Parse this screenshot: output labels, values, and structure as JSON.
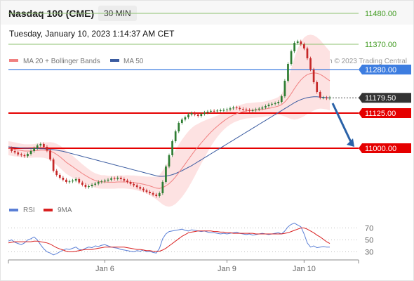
{
  "header": {
    "title": "Nasdaq 100 (CME)",
    "timeframe": "30 MIN",
    "timestamp": "Tuesday, January 10, 2023 1:14:37 AM CET"
  },
  "credit": "Research © 2023 Trading Central",
  "colors": {
    "up_candle": "#2e7d32",
    "down_candle": "#c62828",
    "bollinger_fill": "#fde2e2",
    "ma20": "#f08080",
    "ma50": "#3a5ba0",
    "resistance_green": "#8dc26f",
    "level_blue": "#3d7de0",
    "level_red": "#e50000",
    "rsi": "#5a7fd6",
    "rsi_ma": "#d92020",
    "arrow": "#2a62a8"
  },
  "chart_data": [
    {
      "type": "line",
      "name": "price",
      "title": "Nasdaq 100 (CME)",
      "legend": [
        {
          "label": "MA 20 + Bollinger Bands",
          "color": "#f08080"
        },
        {
          "label": "MA 50",
          "color": "#3a5ba0"
        }
      ],
      "x_ticks": [
        "Jan 6",
        "Jan 9",
        "Jan 10"
      ],
      "ylim": [
        10890,
        11540
      ],
      "levels": [
        {
          "value": 11480.0,
          "label": "11480.00",
          "kind": "resistance",
          "color": "#8dc26f"
        },
        {
          "value": 11370.0,
          "label": "11370.00",
          "kind": "resistance",
          "color": "#8dc26f"
        },
        {
          "value": 11280.0,
          "label": "11280.00",
          "kind": "pivot",
          "color": "#3d7de0"
        },
        {
          "value": 11179.5,
          "label": "11179.50",
          "kind": "last_price",
          "color": "#333333"
        },
        {
          "value": 11125.0,
          "label": "11125.00",
          "kind": "support",
          "color": "#e50000"
        },
        {
          "value": 11000.0,
          "label": "11000.00",
          "kind": "support",
          "color": "#e50000"
        }
      ],
      "close": [
        11000,
        10990,
        10985,
        10978,
        10975,
        10972,
        10980,
        10990,
        11000,
        11010,
        11015,
        11005,
        10992,
        10960,
        10920,
        10905,
        10895,
        10888,
        10880,
        10882,
        10885,
        10890,
        10878,
        10870,
        10862,
        10865,
        10870,
        10874,
        10880,
        10882,
        10885,
        10888,
        10893,
        10891,
        10895,
        10890,
        10885,
        10880,
        10873,
        10868,
        10862,
        10856,
        10850,
        10845,
        10840,
        10835,
        10830,
        10840,
        10880,
        10935,
        10975,
        11025,
        11060,
        11090,
        11102,
        11110,
        11120,
        11125,
        11120,
        11115,
        11122,
        11127,
        11130,
        11133,
        11132,
        11134,
        11135,
        11136,
        11138,
        11142,
        11145,
        11143,
        11140,
        11138,
        11136,
        11134,
        11135,
        11138,
        11141,
        11145,
        11150,
        11155,
        11158,
        11160,
        11165,
        11185,
        11240,
        11300,
        11345,
        11375,
        11380,
        11370,
        11355,
        11320,
        11280,
        11235,
        11200,
        11180,
        11180,
        11178,
        11180
      ],
      "ma20": [
        11000,
        10998,
        10996,
        10994,
        10992,
        10990,
        10990,
        10990,
        10991,
        10992,
        10993,
        10993,
        10992,
        10990,
        10985,
        10978,
        10970,
        10960,
        10950,
        10942,
        10934,
        10926,
        10918,
        10910,
        10903,
        10896,
        10890,
        10885,
        10882,
        10880,
        10880,
        10879,
        10879,
        10879,
        10880,
        10880,
        10880,
        10880,
        10879,
        10878,
        10876,
        10874,
        10872,
        10869,
        10866,
        10862,
        10858,
        10857,
        10860,
        10866,
        10874,
        10885,
        10898,
        10913,
        10928,
        10944,
        10960,
        10976,
        10991,
        11005,
        11019,
        11032,
        11045,
        11057,
        11068,
        11078,
        11088,
        11097,
        11105,
        11112,
        11118,
        11123,
        11127,
        11130,
        11133,
        11134,
        11135,
        11136,
        11137,
        11138,
        11140,
        11142,
        11144,
        11147,
        11150,
        11155,
        11165,
        11178,
        11194,
        11212,
        11229,
        11243,
        11254,
        11262,
        11266,
        11268,
        11267,
        11263,
        11256,
        11248,
        11240
      ],
      "ma50": [
        11005,
        11004,
        11003,
        11002,
        11001,
        11000,
        11000,
        10999,
        10999,
        10999,
        10998,
        10998,
        10997,
        10996,
        10995,
        10993,
        10991,
        10989,
        10986,
        10983,
        10980,
        10977,
        10974,
        10971,
        10968,
        10965,
        10962,
        10959,
        10956,
        10953,
        10950,
        10947,
        10944,
        10941,
        10938,
        10935,
        10932,
        10929,
        10926,
        10923,
        10920,
        10917,
        10914,
        10911,
        10908,
        10905,
        10902,
        10900,
        10900,
        10901,
        10903,
        10906,
        10910,
        10915,
        10920,
        10926,
        10932,
        10938,
        10945,
        10952,
        10959,
        10966,
        10973,
        10980,
        10987,
        10994,
        11001,
        11008,
        11015,
        11022,
        11029,
        11036,
        11043,
        11050,
        11057,
        11064,
        11071,
        11078,
        11085,
        11092,
        11099,
        11106,
        11113,
        11120,
        11127,
        11134,
        11141,
        11148,
        11155,
        11162,
        11168,
        11173,
        11177,
        11180,
        11182,
        11183,
        11183,
        11182,
        11181,
        11180,
        11179
      ],
      "bollinger_width": [
        25,
        25,
        25,
        24,
        24,
        24,
        24,
        24,
        24,
        25,
        26,
        27,
        29,
        32,
        35,
        38,
        40,
        41,
        41,
        40,
        39,
        37,
        35,
        33,
        31,
        29,
        27,
        26,
        25,
        24,
        24,
        23,
        23,
        23,
        23,
        23,
        23,
        24,
        24,
        25,
        26,
        27,
        28,
        30,
        33,
        36,
        40,
        48,
        60,
        72,
        82,
        90,
        96,
        100,
        102,
        102,
        100,
        96,
        90,
        82,
        74,
        66,
        58,
        50,
        44,
        38,
        34,
        31,
        29,
        28,
        27,
        27,
        27,
        27,
        27,
        27,
        27,
        27,
        27,
        27,
        27,
        28,
        29,
        30,
        32,
        38,
        52,
        70,
        90,
        110,
        125,
        135,
        140,
        140,
        138,
        134,
        128,
        122,
        116,
        110,
        105
      ]
    },
    {
      "type": "line",
      "name": "rsi",
      "legend": [
        {
          "label": "RSI",
          "color": "#5a7fd6"
        },
        {
          "label": "9MA",
          "color": "#d92020"
        }
      ],
      "ylim": [
        22,
        82
      ],
      "y_ticks": [
        70,
        50,
        30
      ],
      "rsi": [
        48,
        50,
        46,
        44,
        42,
        45,
        50,
        52,
        55,
        50,
        42,
        35,
        30,
        28,
        25,
        27,
        30,
        33,
        35,
        34,
        36,
        38,
        34,
        33,
        36,
        38,
        37,
        40,
        39,
        41,
        42,
        40,
        38,
        37,
        36,
        34,
        33,
        32,
        31,
        30,
        32,
        31,
        33,
        30,
        31,
        29,
        28,
        36,
        52,
        60,
        64,
        65,
        66,
        67,
        68,
        66,
        65,
        67,
        66,
        65,
        64,
        65,
        63,
        62,
        62,
        61,
        60,
        61,
        60,
        61,
        62,
        63,
        61,
        60,
        59,
        60,
        58,
        59,
        60,
        61,
        60,
        59,
        60,
        61,
        62,
        60,
        65,
        72,
        76,
        78,
        75,
        72,
        60,
        45,
        38,
        40,
        37,
        38,
        39,
        38,
        38
      ],
      "ma9": [
        45,
        46,
        47,
        47,
        47,
        47,
        47,
        47,
        48,
        48,
        47,
        46,
        45,
        43,
        40,
        37,
        35,
        33,
        31,
        30,
        30,
        31,
        32,
        33,
        34,
        34,
        34,
        35,
        36,
        37,
        38,
        38,
        38,
        38,
        38,
        38,
        38,
        37,
        36,
        35,
        34,
        34,
        33,
        32,
        32,
        31,
        31,
        31,
        33,
        36,
        40,
        44,
        48,
        52,
        56,
        59,
        62,
        63,
        64,
        65,
        65,
        65,
        65,
        65,
        64,
        64,
        63,
        63,
        62,
        62,
        61,
        61,
        61,
        61,
        61,
        61,
        61,
        60,
        60,
        60,
        60,
        60,
        60,
        60,
        60,
        60,
        61,
        62,
        64,
        66,
        68,
        70,
        70,
        68,
        65,
        62,
        58,
        55,
        51,
        47,
        44
      ]
    }
  ]
}
